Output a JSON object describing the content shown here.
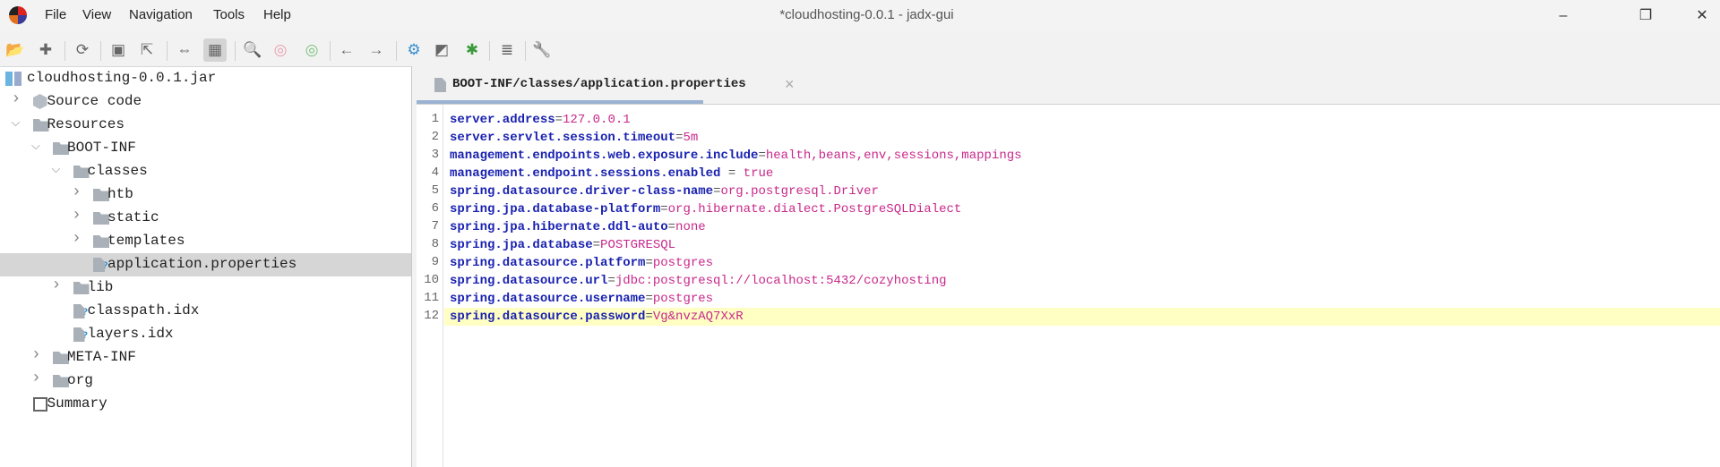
{
  "window": {
    "title": "*cloudhosting-0.0.1 - jadx-gui",
    "controls": [
      "minimize",
      "restore",
      "close"
    ]
  },
  "menu": [
    {
      "label": "File"
    },
    {
      "label": "View"
    },
    {
      "label": "Navigation"
    },
    {
      "label": "Tools"
    },
    {
      "label": "Help"
    }
  ],
  "toolbar": [
    {
      "name": "open-file-icon"
    },
    {
      "name": "add-files-icon"
    },
    {
      "name": "reload-icon"
    },
    {
      "name": "save-all-icon"
    },
    {
      "name": "export-icon"
    },
    {
      "name": "sync-with-editor-icon"
    },
    {
      "name": "flatten-packages-icon",
      "active": true
    },
    {
      "name": "search-text-icon"
    },
    {
      "name": "search-class-icon"
    },
    {
      "name": "find-usage-icon"
    },
    {
      "name": "back-icon"
    },
    {
      "name": "forward-icon"
    },
    {
      "name": "deobfuscation-icon"
    },
    {
      "name": "quark-icon"
    },
    {
      "name": "debugger-icon"
    },
    {
      "name": "log-viewer-icon"
    },
    {
      "name": "preferences-icon"
    }
  ],
  "tree": [
    {
      "label": "cloudhosting-0.0.1.jar",
      "level": 0,
      "icon": "jar-icon"
    },
    {
      "label": "Source code",
      "level": 1,
      "icon": "package-icon",
      "expanded": false
    },
    {
      "label": "Resources",
      "level": 1,
      "icon": "resources-folder-icon",
      "expanded": true
    },
    {
      "label": "BOOT-INF",
      "level": 2,
      "icon": "folder-icon",
      "expanded": true
    },
    {
      "label": "classes",
      "level": 3,
      "icon": "folder-icon",
      "expanded": true
    },
    {
      "label": "htb",
      "level": 4,
      "icon": "folder-icon",
      "expanded": false
    },
    {
      "label": "static",
      "level": 4,
      "icon": "folder-icon",
      "expanded": false
    },
    {
      "label": "templates",
      "level": 4,
      "icon": "folder-icon",
      "expanded": false
    },
    {
      "label": "application.properties",
      "level": 4,
      "icon": "file-icon",
      "selected": true
    },
    {
      "label": "lib",
      "level": 3,
      "icon": "folder-icon",
      "expanded": false
    },
    {
      "label": "classpath.idx",
      "level": 3,
      "icon": "file-icon"
    },
    {
      "label": "layers.idx",
      "level": 3,
      "icon": "file-icon"
    },
    {
      "label": "META-INF",
      "level": 2,
      "icon": "folder-icon",
      "expanded": false
    },
    {
      "label": "org",
      "level": 2,
      "icon": "folder-icon",
      "expanded": false
    },
    {
      "label": "Summary",
      "level": 1,
      "icon": "summary-icon"
    }
  ],
  "editor": {
    "tab": {
      "label": "BOOT-INF/classes/application.properties",
      "close": "×"
    },
    "highlighted_line": 12,
    "lines": [
      {
        "n": "1",
        "key": "server.address",
        "sep": "=",
        "value": "127.0.0.1"
      },
      {
        "n": "2",
        "key": "server.servlet.session.timeout",
        "sep": "=",
        "value": "5m"
      },
      {
        "n": "3",
        "key": "management.endpoints.web.exposure.include",
        "sep": "=",
        "value": "health,beans,env,sessions,mappings"
      },
      {
        "n": "4",
        "key": "management.endpoint.sessions.enabled",
        "sep": " = ",
        "value": "true"
      },
      {
        "n": "5",
        "key": "spring.datasource.driver-class-name",
        "sep": "=",
        "value": "org.postgresql.Driver"
      },
      {
        "n": "6",
        "key": "spring.jpa.database-platform",
        "sep": "=",
        "value": "org.hibernate.dialect.PostgreSQLDialect"
      },
      {
        "n": "7",
        "key": "spring.jpa.hibernate.ddl-auto",
        "sep": "=",
        "value": "none"
      },
      {
        "n": "8",
        "key": "spring.jpa.database",
        "sep": "=",
        "value": "POSTGRESQL"
      },
      {
        "n": "9",
        "key": "spring.datasource.platform",
        "sep": "=",
        "value": "postgres"
      },
      {
        "n": "10",
        "key": "spring.datasource.url",
        "sep": "=",
        "value": "jdbc:postgresql://localhost:5432/cozyhosting"
      },
      {
        "n": "11",
        "key": "spring.datasource.username",
        "sep": "=",
        "value": "postgres"
      },
      {
        "n": "12",
        "key": "spring.datasource.password",
        "sep": "=",
        "value": "Vg&nvzAQ7XxR"
      }
    ]
  },
  "colors": {
    "key": "#1a22b0",
    "value": "#c8288a",
    "highlight": "#ffffc4",
    "selection": "#d6d6d6"
  }
}
